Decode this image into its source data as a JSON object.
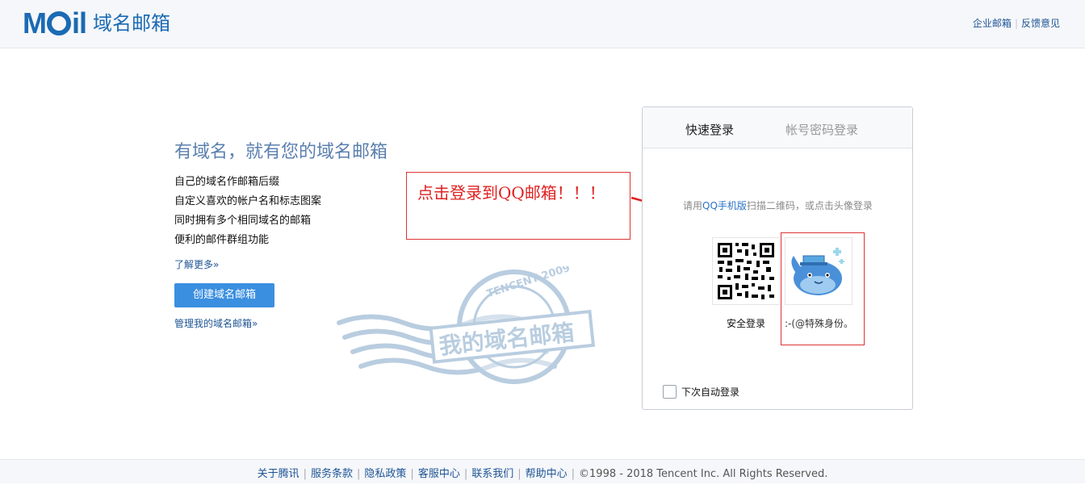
{
  "header": {
    "logo_text": "域名邮箱",
    "links": [
      "企业邮箱",
      "反馈意见"
    ]
  },
  "promo": {
    "title": "有域名，就有您的域名邮箱",
    "features": [
      "自己的域名作邮箱后缀",
      "自定义喜欢的帐户名和标志图案",
      "同时拥有多个相同域名的邮箱",
      "便利的邮件群组功能"
    ],
    "learn_more": "了解更多»",
    "create_button": "创建域名邮箱",
    "manage_link": "管理我的域名邮箱»",
    "stamp_text": "我的域名邮箱",
    "stamp_ring_text": "TENCENT 2009"
  },
  "annotation": {
    "text": "点击登录到QQ邮箱！！！",
    "color": "#e02020"
  },
  "login": {
    "tabs": [
      {
        "label": "快速登录",
        "active": true
      },
      {
        "label": "帐号密码登录",
        "active": false
      }
    ],
    "hint_prefix": "请用",
    "hint_link": "QQ手机版",
    "hint_suffix": "扫描二维码，或点击头像登录",
    "qr_label": "安全登录",
    "avatar_label": ":-(@特殊身份。",
    "auto_login_label": "下次自动登录",
    "auto_login_checked": false
  },
  "footer": {
    "links": [
      "关于腾讯",
      "服务条款",
      "隐私政策",
      "客服中心",
      "联系我们",
      "帮助中心"
    ],
    "copyright": "©1998 - 2018 Tencent Inc. All Rights Reserved."
  },
  "colors": {
    "brand": "#1b6ab3",
    "button": "#3b8fe0",
    "link": "#1e5494"
  }
}
